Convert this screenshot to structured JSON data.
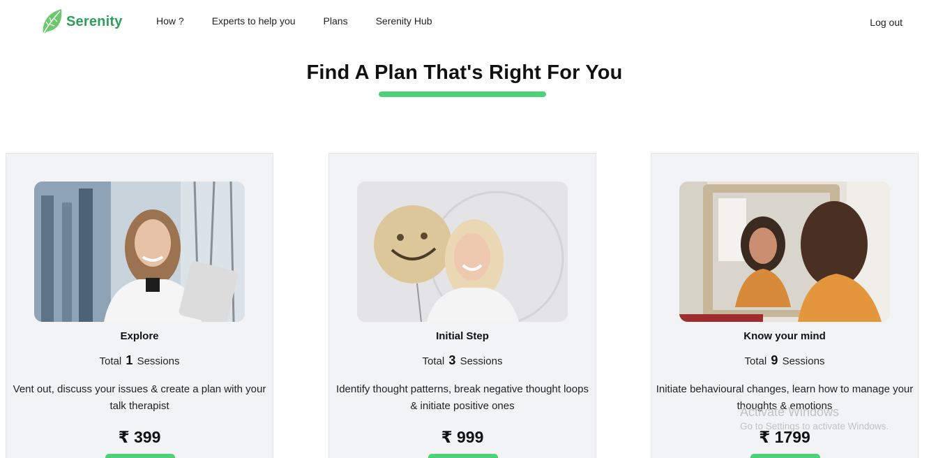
{
  "nav": {
    "brand": "Serenity",
    "links": [
      "How ?",
      "Experts to help you",
      "Plans",
      "Serenity Hub"
    ],
    "logout": "Log out",
    "brand_color": "#2f9e5c"
  },
  "page": {
    "title": "Find A Plan That's Right For You",
    "accent_color": "#4fd17a"
  },
  "plans": [
    {
      "name": "Explore",
      "sessions_prefix": "Total",
      "sessions_count": "1",
      "sessions_suffix": "Sessions",
      "description": "Vent out, discuss your issues & create a plan with your talk therapist",
      "price": "₹ 399",
      "image": "woman-smiling-with-tablet-photo"
    },
    {
      "name": "Initial Step",
      "sessions_prefix": "Total",
      "sessions_count": "3",
      "sessions_suffix": "Sessions",
      "description": "Identify thought patterns, break negative thought loops & initiate positive ones",
      "price": "₹ 999",
      "image": "woman-with-smiley-balloon-photo"
    },
    {
      "name": "Know your mind",
      "sessions_prefix": "Total",
      "sessions_count": "9",
      "sessions_suffix": "Sessions",
      "description": "Initiate behavioural changes, learn how to manage your thoughts & emotions",
      "price": "₹ 1799",
      "image": "woman-smiling-in-mirror-photo"
    }
  ],
  "watermark": {
    "line1": "Activate Windows",
    "line2": "Go to Settings to activate Windows."
  }
}
